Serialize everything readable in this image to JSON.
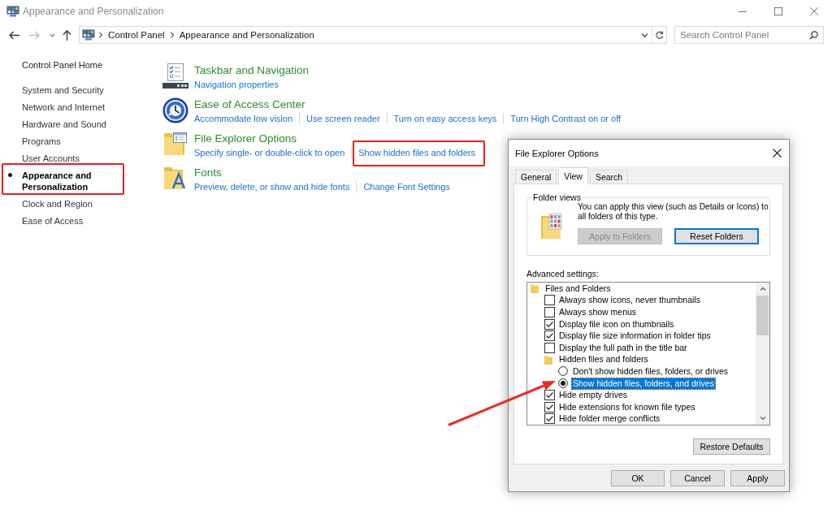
{
  "window": {
    "title": "Appearance and Personalization"
  },
  "address_bar": {
    "breadcrumbs": [
      "Control Panel",
      "Appearance and Personalization"
    ]
  },
  "search": {
    "placeholder": "Search Control Panel"
  },
  "sidebar": {
    "home": "Control Panel Home",
    "items": [
      {
        "label": "System and Security",
        "selected": false,
        "highlighted": false
      },
      {
        "label": "Network and Internet",
        "selected": false,
        "highlighted": false
      },
      {
        "label": "Hardware and Sound",
        "selected": false,
        "highlighted": false
      },
      {
        "label": "Programs",
        "selected": false,
        "highlighted": false
      },
      {
        "label": "User Accounts",
        "selected": false,
        "highlighted": false
      },
      {
        "label": "Appearance and Personalization",
        "selected": true,
        "highlighted": true
      },
      {
        "label": "Clock and Region",
        "selected": false,
        "highlighted": false
      },
      {
        "label": "Ease of Access",
        "selected": false,
        "highlighted": false
      }
    ]
  },
  "categories": [
    {
      "title": "Taskbar and Navigation",
      "links": [
        {
          "label": "Navigation properties",
          "highlighted": false
        }
      ]
    },
    {
      "title": "Ease of Access Center",
      "links": [
        {
          "label": "Accommodate low vision",
          "highlighted": false
        },
        {
          "label": "Use screen reader",
          "highlighted": false
        },
        {
          "label": "Turn on easy access keys",
          "highlighted": false
        },
        {
          "label": "Turn High Contrast on or off",
          "highlighted": false
        }
      ]
    },
    {
      "title": "File Explorer Options",
      "links": [
        {
          "label": "Specify single- or double-click to open",
          "highlighted": false
        },
        {
          "label": "Show hidden files and folders",
          "highlighted": true
        }
      ]
    },
    {
      "title": "Fonts",
      "links": [
        {
          "label": "Preview, delete, or show and hide fonts",
          "highlighted": false
        },
        {
          "label": "Change Font Settings",
          "highlighted": false
        }
      ]
    }
  ],
  "dialog": {
    "title": "File Explorer Options",
    "tabs": [
      {
        "label": "General",
        "selected": false
      },
      {
        "label": "View",
        "selected": true
      },
      {
        "label": "Search",
        "selected": false
      }
    ],
    "folder_views": {
      "legend": "Folder views",
      "text": "You can apply this view (such as Details or Icons) to all folders of this type.",
      "buttons": [
        {
          "label": "Apply to Folders",
          "disabled": true,
          "default": false
        },
        {
          "label": "Reset Folders",
          "disabled": false,
          "default": true
        }
      ]
    },
    "advanced": {
      "label": "Advanced settings:",
      "tree": [
        {
          "kind": "folder",
          "label": "Files and Folders",
          "selected": false,
          "children": [
            {
              "kind": "checkbox",
              "label": "Always show icons, never thumbnails",
              "checked": false,
              "selected": false
            },
            {
              "kind": "checkbox",
              "label": "Always show menus",
              "checked": false,
              "selected": false
            },
            {
              "kind": "checkbox",
              "label": "Display file icon on thumbnails",
              "checked": true,
              "selected": false
            },
            {
              "kind": "checkbox",
              "label": "Display file size information in folder tips",
              "checked": true,
              "selected": false
            },
            {
              "kind": "checkbox",
              "label": "Display the full path in the title bar",
              "checked": false,
              "selected": false
            },
            {
              "kind": "folder",
              "label": "Hidden files and folders",
              "selected": false,
              "children": [
                {
                  "kind": "radio",
                  "label": "Don't show hidden files, folders, or drives",
                  "checked": false,
                  "selected": false
                },
                {
                  "kind": "radio",
                  "label": "Show hidden files, folders, and drives",
                  "checked": true,
                  "selected": true
                }
              ]
            },
            {
              "kind": "checkbox",
              "label": "Hide empty drives",
              "checked": true,
              "selected": false
            },
            {
              "kind": "checkbox",
              "label": "Hide extensions for known file types",
              "checked": true,
              "selected": false
            },
            {
              "kind": "checkbox",
              "label": "Hide folder merge conflicts",
              "checked": true,
              "selected": false
            }
          ]
        }
      ]
    },
    "restore_button": "Restore Defaults",
    "buttons": [
      "OK",
      "Cancel",
      "Apply"
    ]
  }
}
